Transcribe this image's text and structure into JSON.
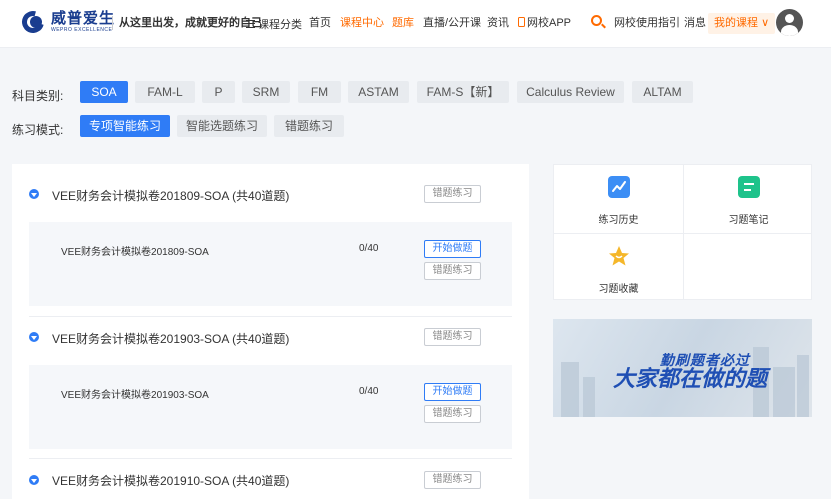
{
  "header": {
    "brand_cn": "威普爱生",
    "brand_en": "WEPRO EXCELLENCE",
    "slogan": "从这里出发，成就更好的自己",
    "nav_category": "课程分类",
    "nav": [
      {
        "label": "首页",
        "active": false
      },
      {
        "label": "课程中心",
        "active": true
      },
      {
        "label": "题库",
        "active": false
      },
      {
        "label": "直播/公开课",
        "active": false
      },
      {
        "label": "资讯",
        "active": false
      }
    ],
    "app_label": "网校APP",
    "guide": "网校使用指引",
    "messages": "消息",
    "my_course": "我的课程"
  },
  "filters": {
    "subject_label": "科目类别:",
    "subjects": [
      "SOA",
      "FAM-L",
      "P",
      "SRM",
      "FM",
      "ASTAM",
      "FAM-S【新】",
      "Calculus Review",
      "ALTAM"
    ],
    "subject_selected": "SOA",
    "mode_label": "练习模式:",
    "modes": [
      "专项智能练习",
      "智能选题练习",
      "错题练习"
    ],
    "mode_selected": "专项智能练习"
  },
  "groups": [
    {
      "title": "VEE财务会计模拟卷201809-SOA (共40道题)",
      "wrong_btn": "错题练习",
      "items": [
        {
          "name": "VEE财务会计模拟卷201809-SOA",
          "progress": "0/40",
          "start_btn": "开始做题",
          "wrong_btn": "错题练习"
        }
      ]
    },
    {
      "title": "VEE财务会计模拟卷201903-SOA (共40道题)",
      "wrong_btn": "错题练习",
      "items": [
        {
          "name": "VEE财务会计模拟卷201903-SOA",
          "progress": "0/40",
          "start_btn": "开始做题",
          "wrong_btn": "错题练习"
        }
      ]
    },
    {
      "title": "VEE财务会计模拟卷201910-SOA (共40道题)",
      "wrong_btn": "错题练习",
      "items": []
    }
  ],
  "tools": [
    {
      "label": "练习历史",
      "icon": "chart-line-icon",
      "color": "#3c8ef5"
    },
    {
      "label": "习题笔记",
      "icon": "note-icon",
      "color": "#1ec38b"
    },
    {
      "label": "习题收藏",
      "icon": "star-icon",
      "color": "#f5b72a"
    }
  ],
  "banner": {
    "line1": "勤刷题者必过",
    "line2": "大家都在做的题"
  },
  "colors": {
    "primary": "#2f7cf6",
    "accent": "#ff6a00",
    "brand": "#1a3d8f"
  }
}
